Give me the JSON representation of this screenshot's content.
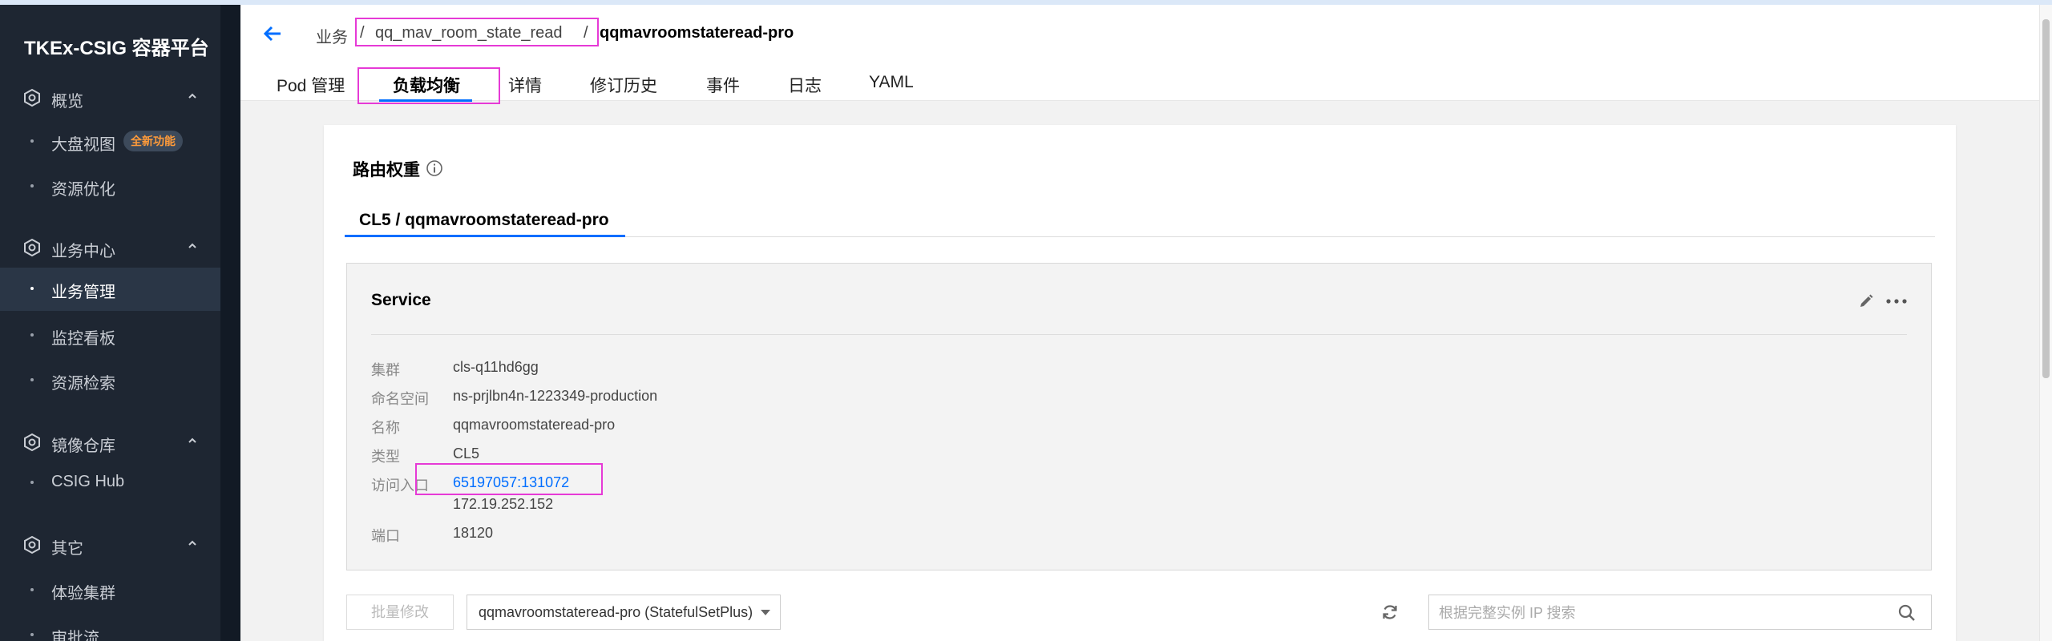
{
  "sidebar": {
    "brand": "TKEx-CSIG 容器平台",
    "groups": [
      {
        "label": "概览",
        "items": [
          {
            "label": "大盘视图",
            "badge": "全新功能"
          },
          {
            "label": "资源优化"
          }
        ]
      },
      {
        "label": "业务中心",
        "items": [
          {
            "label": "业务管理",
            "active": true
          },
          {
            "label": "监控看板"
          },
          {
            "label": "资源检索"
          }
        ]
      },
      {
        "label": "镜像仓库",
        "items": [
          {
            "label": "CSIG Hub"
          }
        ]
      },
      {
        "label": "其它",
        "items": [
          {
            "label": "体验集群"
          },
          {
            "label": "审批流"
          }
        ]
      }
    ]
  },
  "header": {
    "breadcrumb": {
      "root": "业务",
      "separator": "/",
      "link": "qq_mav_room_state_read",
      "current": "qqmavroomstateread-pro"
    },
    "tabs": [
      {
        "label": "Pod 管理"
      },
      {
        "label": "负载均衡",
        "active": true
      },
      {
        "label": "详情"
      },
      {
        "label": "修订历史"
      },
      {
        "label": "事件"
      },
      {
        "label": "日志"
      },
      {
        "label": "YAML"
      }
    ]
  },
  "main": {
    "section_title": "路由权重",
    "subtab": "CL5 / qqmavroomstateread-pro",
    "service": {
      "title": "Service",
      "fields": [
        {
          "label": "集群",
          "value": "cls-q11hd6gg"
        },
        {
          "label": "命名空间",
          "value": "ns-prjlbn4n-1223349-production"
        },
        {
          "label": "名称",
          "value": "qqmavroomstateread-pro"
        },
        {
          "label": "类型",
          "value": "CL5"
        },
        {
          "label": "访问入口",
          "value": "65197057:131072",
          "value2": "172.19.252.152"
        },
        {
          "label": "端口",
          "value": "18120"
        }
      ]
    },
    "toolbar": {
      "batch_label": "批量修改",
      "select_value": "qqmavroomstateread-pro (StatefulSetPlus)",
      "search_placeholder": "根据完整实例 IP 搜索"
    }
  },
  "colors": {
    "accent": "#006eff",
    "highlight": "#e63ad6",
    "sidebar_bg": "#1e2632",
    "badge_text": "#ff9b3a"
  }
}
